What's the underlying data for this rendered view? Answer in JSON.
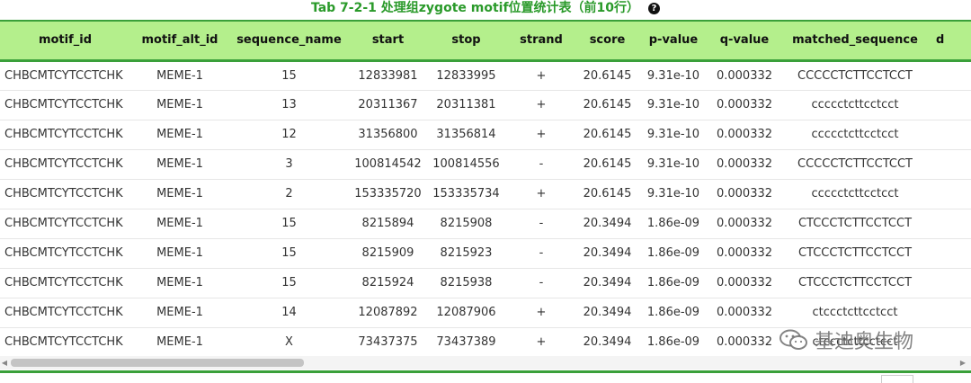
{
  "caption": {
    "text": "Tab 7-2-1 处理组zygote motif位置统计表（前10行）",
    "help_icon": "?"
  },
  "table": {
    "columns": [
      "motif_id",
      "motif_alt_id",
      "sequence_name",
      "start",
      "stop",
      "strand",
      "score",
      "p-value",
      "q-value",
      "matched_sequence",
      "d"
    ],
    "rows": [
      [
        "CHBCMTCYTCCTCHK",
        "MEME-1",
        "15",
        "12833981",
        "12833995",
        "+",
        "20.6145",
        "9.31e-10",
        "0.000332",
        "CCCCCTCTTCCTCCT"
      ],
      [
        "CHBCMTCYTCCTCHK",
        "MEME-1",
        "13",
        "20311367",
        "20311381",
        "+",
        "20.6145",
        "9.31e-10",
        "0.000332",
        "ccccctcttcctcct"
      ],
      [
        "CHBCMTCYTCCTCHK",
        "MEME-1",
        "12",
        "31356800",
        "31356814",
        "+",
        "20.6145",
        "9.31e-10",
        "0.000332",
        "ccccctcttcctcct"
      ],
      [
        "CHBCMTCYTCCTCHK",
        "MEME-1",
        "3",
        "100814542",
        "100814556",
        "-",
        "20.6145",
        "9.31e-10",
        "0.000332",
        "CCCCCTCTTCCTCCT"
      ],
      [
        "CHBCMTCYTCCTCHK",
        "MEME-1",
        "2",
        "153335720",
        "153335734",
        "+",
        "20.6145",
        "9.31e-10",
        "0.000332",
        "ccccctcttcctcct"
      ],
      [
        "CHBCMTCYTCCTCHK",
        "MEME-1",
        "15",
        "8215894",
        "8215908",
        "-",
        "20.3494",
        "1.86e-09",
        "0.000332",
        "CTCCCTCTTCCTCCT"
      ],
      [
        "CHBCMTCYTCCTCHK",
        "MEME-1",
        "15",
        "8215909",
        "8215923",
        "-",
        "20.3494",
        "1.86e-09",
        "0.000332",
        "CTCCCTCTTCCTCCT"
      ],
      [
        "CHBCMTCYTCCTCHK",
        "MEME-1",
        "15",
        "8215924",
        "8215938",
        "-",
        "20.3494",
        "1.86e-09",
        "0.000332",
        "CTCCCTCTTCCTCCT"
      ],
      [
        "CHBCMTCYTCCTCHK",
        "MEME-1",
        "14",
        "12087892",
        "12087906",
        "+",
        "20.3494",
        "1.86e-09",
        "0.000332",
        "ctccctcttcctcct"
      ],
      [
        "CHBCMTCYTCCTCHK",
        "MEME-1",
        "X",
        "73437375",
        "73437389",
        "+",
        "20.3494",
        "1.86e-09",
        "0.000332",
        "ctccctcttcctcct"
      ]
    ]
  },
  "watermark": {
    "text": "基迪奥生物",
    "icon": "wechat-icon"
  },
  "scrollbar": {
    "left_arrow": "◀",
    "right_arrow": "▶"
  },
  "colors": {
    "caption": "#2a9a2a",
    "header_bg": "#b4ef8c",
    "header_border": "#3aa03a"
  }
}
